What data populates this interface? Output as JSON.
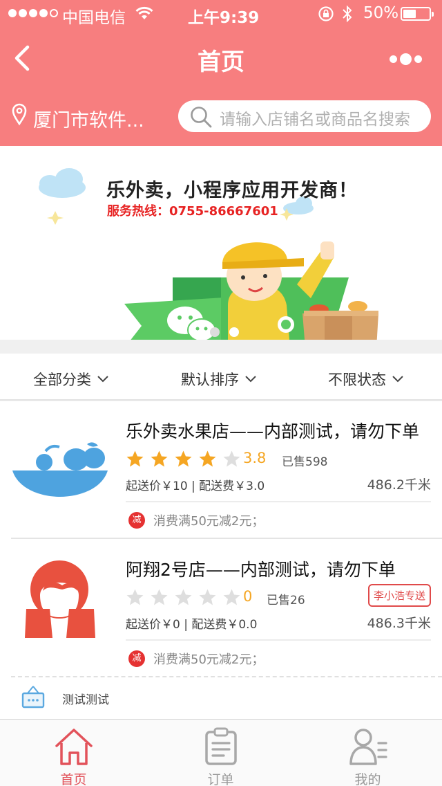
{
  "status_bar": {
    "carrier": "中国电信",
    "time": "上午9:39",
    "battery": "50%",
    "battery_level": 0.5
  },
  "nav": {
    "title": "首页"
  },
  "location": {
    "city": "厦门市软件...",
    "search_placeholder": "请输入店铺名或商品名搜索"
  },
  "banner": {
    "slogan": "乐外卖，小程序应用开发商！",
    "hotline": "服务热线：0755-86667601"
  },
  "filters": [
    {
      "label": "全部分类"
    },
    {
      "label": "默认排序"
    },
    {
      "label": "不限状态"
    }
  ],
  "stores": [
    {
      "name": "乐外卖水果店——内部测试，请勿下单",
      "rating": "3.8",
      "stars_filled": 4,
      "sold": "已售598",
      "fees": "起送价￥10 | 配送费￥3.0",
      "distance": "486.2千米",
      "promo_badge": "减",
      "promo": "消费满50元减2元；"
    },
    {
      "name": "阿翔2号店——内部测试，请勿下单",
      "rating": "0",
      "stars_filled": 0,
      "sold": "已售26",
      "fees": "起送价￥0 | 配送费￥0.0",
      "distance": "486.3千米",
      "courier_tag": "李小浩专送",
      "promo_badge": "减",
      "promo": "消费满50元减2元；"
    }
  ],
  "partial_item": {
    "label": "测试测试"
  },
  "tabs": [
    {
      "label": "首页",
      "icon": "home-icon",
      "active": true
    },
    {
      "label": "订单",
      "icon": "order-icon",
      "active": false
    },
    {
      "label": "我的",
      "icon": "profile-icon",
      "active": false
    }
  ],
  "colors": {
    "brand": "#f77e7f",
    "star_on": "#f5a623",
    "star_off": "#dedede",
    "promo": "#e53232",
    "tab_active": "#e2525a"
  }
}
